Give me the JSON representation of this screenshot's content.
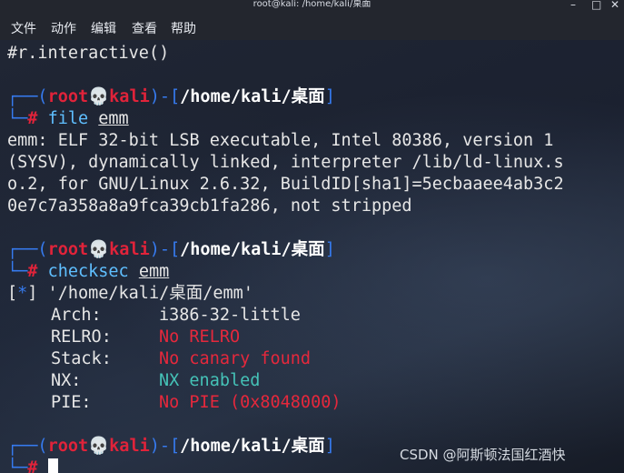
{
  "window": {
    "title": "root@kali: /home/kali/桌面",
    "minimize_glyph": "–",
    "maximize_glyph": "□",
    "close_glyph": "✕"
  },
  "menu": [
    "文件",
    "动作",
    "编辑",
    "查看",
    "帮助"
  ],
  "terminal": {
    "prev_line": "#r.interactive()",
    "prompt": {
      "open": "┌──(",
      "user": "root",
      "skull": "💀",
      "host": "kali",
      "mid": ")-[",
      "path": "/home/kali/桌面",
      "close": "]",
      "second_prefix": "└─",
      "hash": "#"
    },
    "cmd1": {
      "bin": "file",
      "arg": "emm"
    },
    "file_output": [
      "emm: ELF 32-bit LSB executable, Intel 80386, version 1",
      "(SYSV), dynamically linked, interpreter /lib/ld-linux.s",
      "o.2, for GNU/Linux 2.6.32, BuildID[sha1]=5ecbaaee4ab3c2",
      "0e7c7a358a8a9fca39cb1fa286, not stripped"
    ],
    "cmd2": {
      "bin": "checksec",
      "arg": "emm"
    },
    "checksec": {
      "bracket_open": "[",
      "star": "*",
      "bracket_close": "]",
      "path": " '/home/kali/桌面/emm'",
      "rows": [
        {
          "key": "Arch:",
          "value": "i386-32-little",
          "status": "neutral"
        },
        {
          "key": "RELRO:",
          "value": "No RELRO",
          "status": "bad"
        },
        {
          "key": "Stack:",
          "value": "No canary found",
          "status": "bad"
        },
        {
          "key": "NX:",
          "value": "NX enabled",
          "status": "good"
        },
        {
          "key": "PIE:",
          "value": "No PIE (0x8048000)",
          "status": "bad"
        }
      ]
    }
  },
  "watermark": "CSDN @阿斯顿法国红酒快",
  "colors": {
    "prompt_blue": "#367bf0",
    "prompt_red": "#e0233a",
    "bad": "#e5283c",
    "good": "#45c2b7",
    "command": "#5fbfff"
  }
}
